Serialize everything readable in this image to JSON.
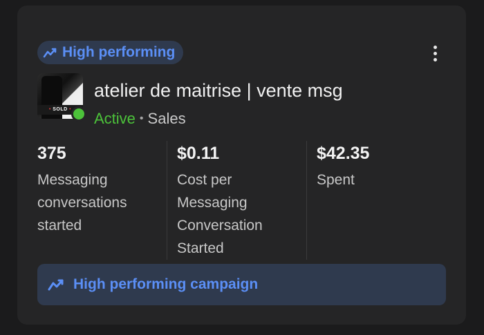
{
  "card": {
    "badge_label": "High performing",
    "account": {
      "name": "atelier de maitrise | vente msg",
      "thumbnail_text": "SOLD",
      "status": "Active",
      "separator": "•",
      "objective": "Sales"
    },
    "metrics": [
      {
        "value": "375",
        "label": "Messaging conversations started"
      },
      {
        "value": "$0.11",
        "label": "Cost per Messaging Conversation Started"
      },
      {
        "value": "$42.35",
        "label": "Spent"
      }
    ],
    "banner_label": "High performing campaign"
  },
  "colors": {
    "accent_blue": "#5b8ff6",
    "active_green": "#4cc23a",
    "card_bg": "#252526",
    "badge_bg": "#2f3a4e"
  },
  "icons": {
    "badge": "trend-up-icon",
    "menu": "more-vertical-icon",
    "banner": "trend-up-icon"
  }
}
